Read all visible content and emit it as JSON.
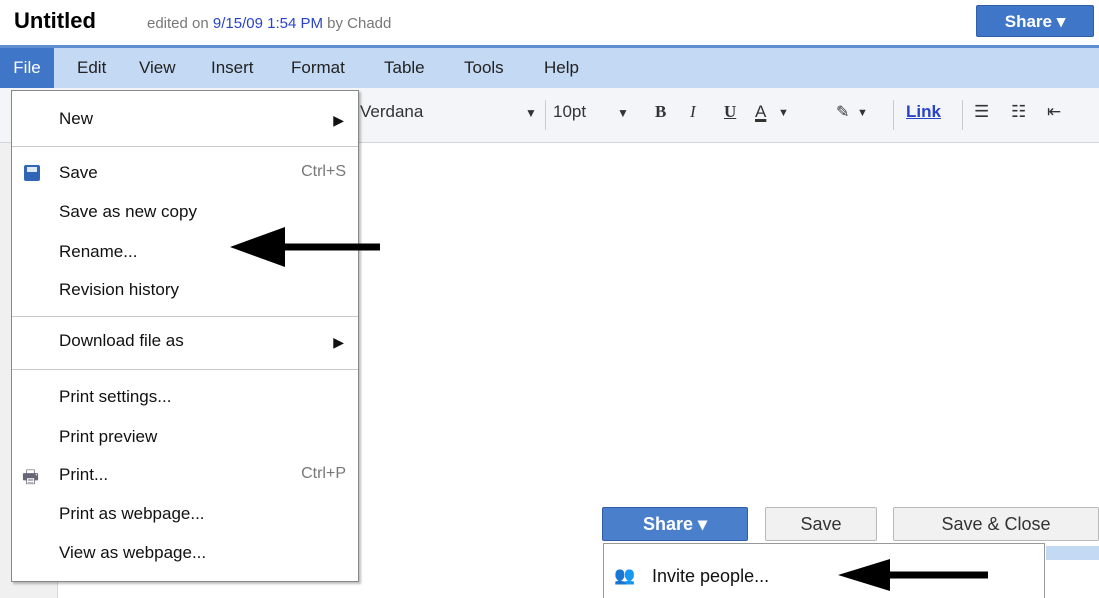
{
  "header": {
    "title": "Untitled",
    "edited_prefix": "edited on ",
    "edited_date": "9/15/09 1:54 PM",
    "edited_suffix": " by Chadd",
    "share_label": "Share ▾"
  },
  "menubar": [
    "File",
    "Edit",
    "View",
    "Insert",
    "Format",
    "Table",
    "Tools",
    "Help"
  ],
  "toolbar": {
    "font": "Verdana",
    "size": "10pt",
    "bold": "B",
    "italic": "I",
    "underline": "U",
    "text_color": "A",
    "link": "Link"
  },
  "file_menu": {
    "new": "New",
    "save": "Save",
    "save_shortcut": "Ctrl+S",
    "save_copy": "Save as new copy",
    "rename": "Rename...",
    "revision": "Revision history",
    "download": "Download file as",
    "print_settings": "Print settings...",
    "print_preview": "Print preview",
    "print": "Print...",
    "print_shortcut": "Ctrl+P",
    "print_webpage": "Print as webpage...",
    "view_webpage": "View as webpage..."
  },
  "bottom_bar": {
    "share": "Share ▾",
    "save": "Save",
    "save_close": "Save & Close",
    "invite": "Invite people..."
  },
  "colors": {
    "accent": "#3f76c7",
    "menubar": "#c4d9f3",
    "link": "#2a44c9"
  }
}
